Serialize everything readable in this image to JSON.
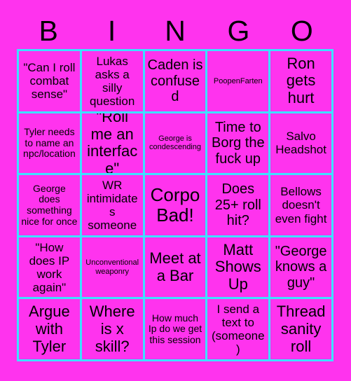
{
  "card": {
    "title": "BINGO",
    "background_color": "#ff33ee",
    "border_color": "#3de1ff",
    "text_color": "#000000"
  },
  "header": {
    "letters": [
      {
        "label": "B"
      },
      {
        "label": "I"
      },
      {
        "label": "N"
      },
      {
        "label": "G"
      },
      {
        "label": "O"
      }
    ]
  },
  "grid": {
    "columns": 5,
    "rows": 5,
    "cells": [
      {
        "text": "\"Can I roll combat sense\"",
        "size": "md"
      },
      {
        "text": "Lukas asks a silly question",
        "size": "md"
      },
      {
        "text": "Caden is confused",
        "size": "lg"
      },
      {
        "text": "PoopenFarten",
        "size": "xs"
      },
      {
        "text": "Ron gets hurt",
        "size": "xl"
      },
      {
        "text": "Tyler needs to name an npc/location",
        "size": "sm"
      },
      {
        "text": "\"Roll me an interface\"",
        "size": "xl"
      },
      {
        "text": "George is condescending",
        "size": "xs"
      },
      {
        "text": "Time to Borg the fuck up",
        "size": "lg"
      },
      {
        "text": "Salvo Headshot",
        "size": "md"
      },
      {
        "text": "George does something nice for once",
        "size": "sm"
      },
      {
        "text": "WR intimidates someone",
        "size": "md"
      },
      {
        "text": "Corpo Bad!",
        "size": "xxl"
      },
      {
        "text": "Does 25+ roll hit?",
        "size": "lg"
      },
      {
        "text": "Bellows doesn't even fight",
        "size": "md"
      },
      {
        "text": "\"How does IP work again\"",
        "size": "md"
      },
      {
        "text": "Unconventional weaponry",
        "size": "xs"
      },
      {
        "text": "Meet at a Bar",
        "size": "xl"
      },
      {
        "text": "Matt Shows Up",
        "size": "xl"
      },
      {
        "text": "\"George knows a guy\"",
        "size": "lg"
      },
      {
        "text": "Argue with Tyler",
        "size": "xl"
      },
      {
        "text": "Where is x skill?",
        "size": "xl"
      },
      {
        "text": "How much Ip do we get this session",
        "size": "sm"
      },
      {
        "text": "I send a text to (someone)",
        "size": "md"
      },
      {
        "text": "Thread sanity roll",
        "size": "xl"
      }
    ]
  }
}
